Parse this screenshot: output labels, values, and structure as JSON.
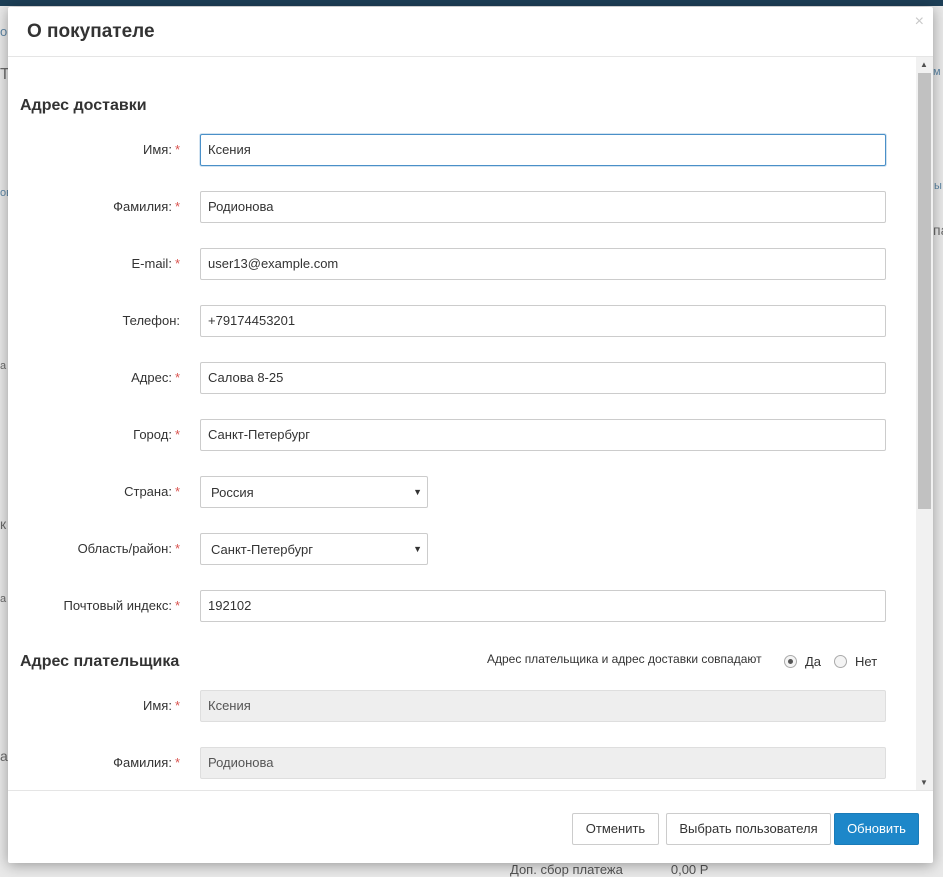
{
  "background": {
    "fragments": [
      "о",
      "Т",
      "ов",
      "м",
      "ы",
      "па",
      "а",
      "к",
      "а",
      "а"
    ],
    "bottom_label": "Доп. сбор платежа",
    "bottom_value": "0,00 Р"
  },
  "modal": {
    "title": "О покупателе",
    "close_icon": "×",
    "shipping": {
      "title": "Адрес доставки",
      "fields": [
        {
          "label": "Имя:",
          "required": true,
          "value": "Ксения"
        },
        {
          "label": "Фамилия:",
          "required": true,
          "value": "Родионова"
        },
        {
          "label": "E-mail:",
          "required": true,
          "value": "user13@example.com"
        },
        {
          "label": "Телефон:",
          "required": false,
          "value": "+79174453201"
        },
        {
          "label": "Адрес:",
          "required": true,
          "value": "Салова 8-25"
        },
        {
          "label": "Город:",
          "required": true,
          "value": "Санкт-Петербург"
        },
        {
          "label": "Страна:",
          "required": true,
          "value": "Россия"
        },
        {
          "label": "Область/район:",
          "required": true,
          "value": "Санкт-Петербург"
        },
        {
          "label": "Почтовый индекс:",
          "required": true,
          "value": "192102"
        }
      ]
    },
    "billing": {
      "title": "Адрес плательщика",
      "same_question": "Адрес плательщика и адрес доставки совпадают",
      "yes_label": "Да",
      "no_label": "Нет",
      "same_selected": "yes",
      "fields": [
        {
          "label": "Имя:",
          "required": true,
          "value": "Ксения"
        },
        {
          "label": "Фамилия:",
          "required": true,
          "value": "Родионова"
        }
      ]
    },
    "required_mark": "*",
    "buttons": {
      "cancel": "Отменить",
      "select_user": "Выбрать пользователя",
      "update": "Обновить"
    },
    "colors": {
      "primary": "#1d87c9",
      "required": "#d9534f",
      "focus": "#4a90c8"
    }
  }
}
